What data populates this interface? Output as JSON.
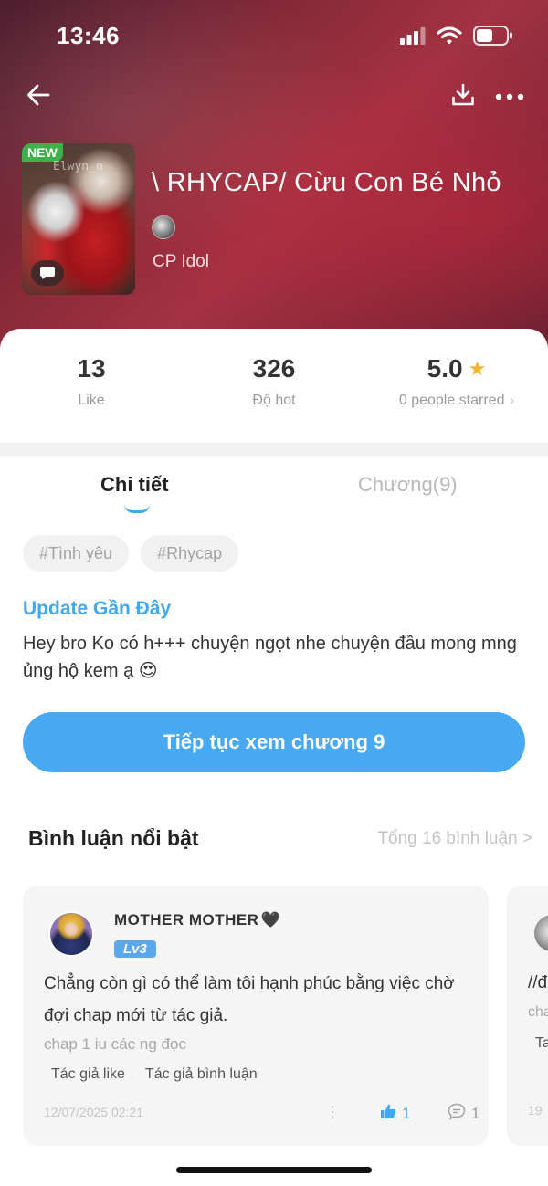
{
  "status_bar": {
    "time": "13:46"
  },
  "book": {
    "cover_badge": "NEW",
    "cover_watermark": "Elwyn_n",
    "title": "\\ RHYCAP/ Cừu Con Bé Nhỏ",
    "category": "CP Idol"
  },
  "stats": {
    "likes": {
      "value": "13",
      "label": "Like"
    },
    "hot": {
      "value": "326",
      "label": "Độ hot"
    },
    "rating": {
      "value": "5.0",
      "label": "0 people starred"
    }
  },
  "tabs": [
    {
      "label": "Chi tiết",
      "active": true
    },
    {
      "label": "Chương(9)",
      "active": false
    }
  ],
  "tags": [
    "#Tình yêu",
    "#Rhycap"
  ],
  "update": {
    "title": "Update Gần Đây",
    "text": "Hey bro Ko có h+++ chuyện ngọt nhe chuyện đầu mong mng ủng hộ kem ạ 😍"
  },
  "cta": {
    "label": "Tiếp tục xem chương 9"
  },
  "comments": {
    "header": "Bình luận nổi bật",
    "total": "Tổng 16 bình luận >",
    "items": [
      {
        "user": "MOTHER MOTHER",
        "user_emoji": "🖤",
        "level": "Lv3",
        "text": "Chẳng còn gì có thể làm tôi hạnh phúc bằng việc chờ đợi chap mới từ tác giả.",
        "subtext": "chap 1 iu các ng đọc",
        "badges": [
          "Tác giả like",
          "Tác giả bình luận"
        ],
        "date": "12/07/2025 02:21",
        "likes": "1",
        "replies": "1"
      }
    ],
    "peek": {
      "text": "//đ",
      "sub": "cha",
      "sub2": "Ta",
      "date": "19"
    }
  },
  "colors": {
    "accent": "#3ea9ef",
    "cta": "#46a9f2",
    "star": "#f5b731",
    "new_badge": "#3fb14a"
  },
  "icons": [
    "back-arrow-icon",
    "download-icon",
    "more-icon",
    "star-icon",
    "chat-bubble-icon",
    "thumbs-up-icon",
    "comment-icon",
    "vertical-dots-icon",
    "wifi-icon",
    "signal-icon",
    "battery-icon"
  ]
}
